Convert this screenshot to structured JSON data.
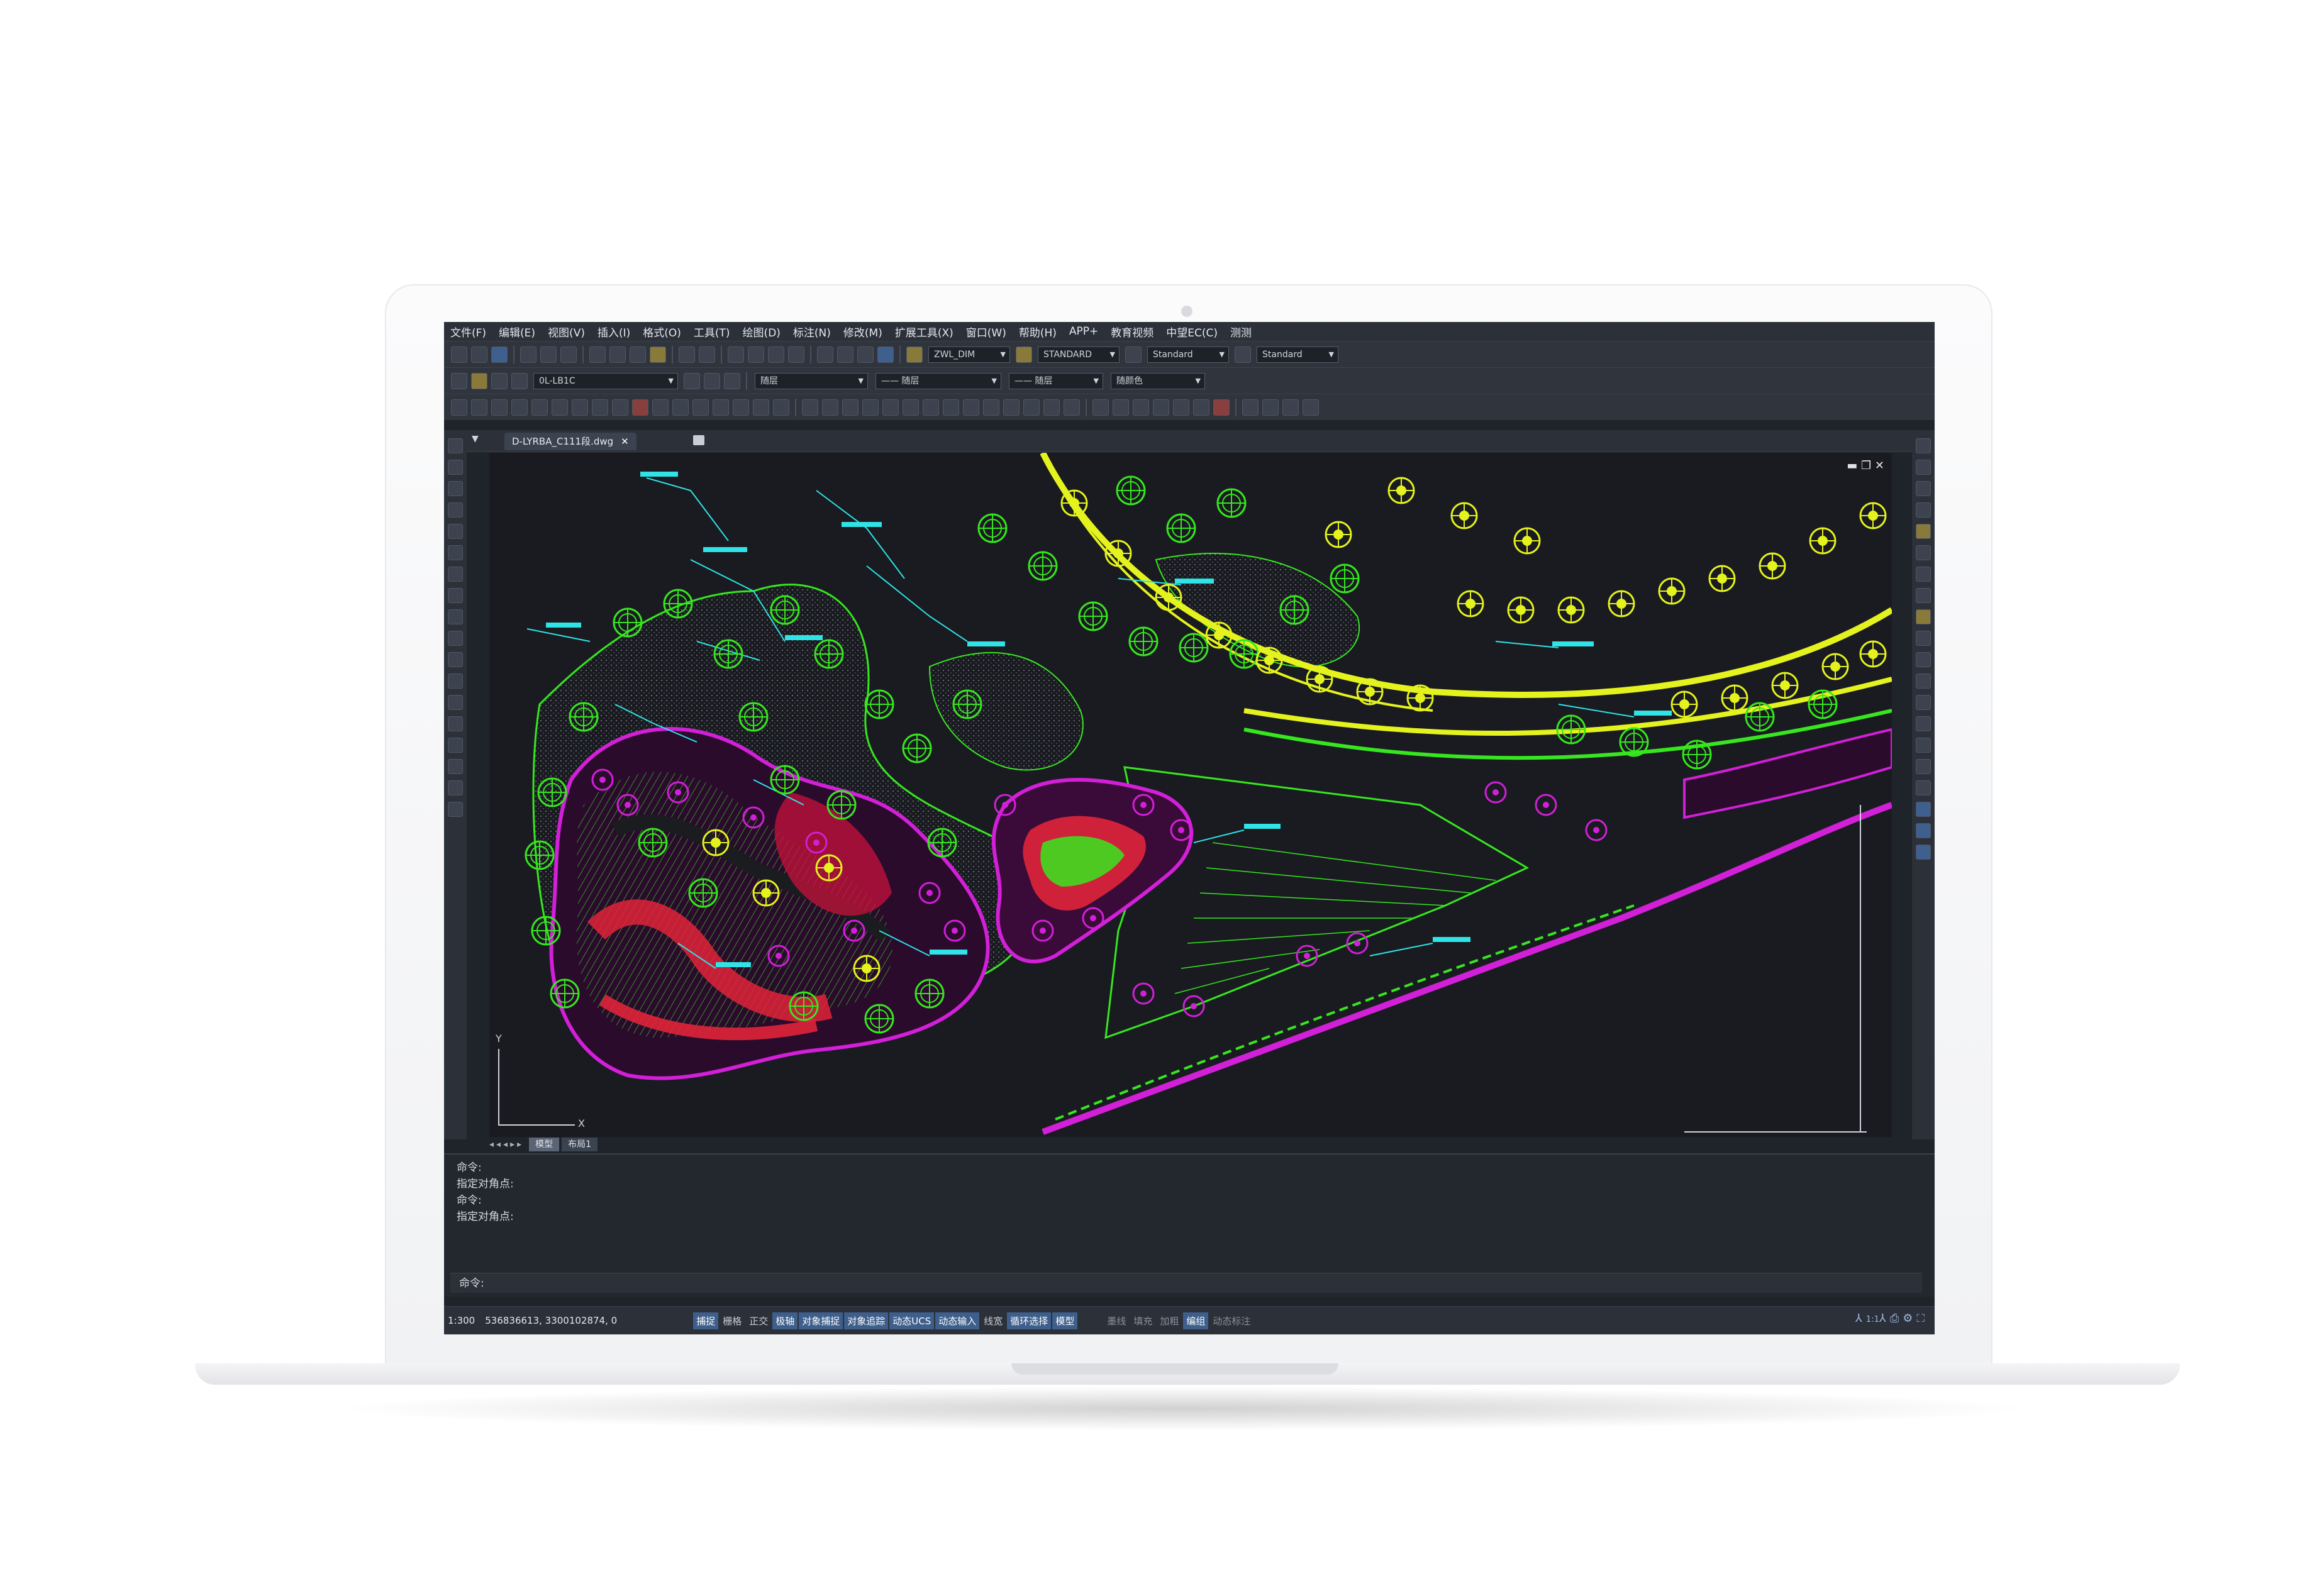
{
  "menu": [
    "文件(F)",
    "编辑(E)",
    "视图(V)",
    "插入(I)",
    "格式(O)",
    "工具(T)",
    "绘图(D)",
    "标注(N)",
    "修改(M)",
    "扩展工具(X)",
    "窗口(W)",
    "帮助(H)",
    "APP+",
    "教育视频",
    "中望EC(C)",
    "测测"
  ],
  "toolbar1": {
    "dimstyle": "ZWL_DIM",
    "textstyle": "STANDARD",
    "tablestyle": "Standard",
    "mleaderstyle": "Standard"
  },
  "toolbar2": {
    "layer": "0L-LB1C",
    "color": "随层",
    "linetype": "—— 随层",
    "lineweight": "—— 随层",
    "plotstyle": "随颜色"
  },
  "document": {
    "tab_label": "D-LYRBA_C111段.dwg",
    "close_icon": "✕"
  },
  "layout_tabs": [
    "模型",
    "布局1"
  ],
  "command_history": [
    "命令:",
    "指定对角点:",
    "命令:",
    "指定对角点:"
  ],
  "command_prompt": "命令:",
  "status": {
    "scale": "1:300",
    "coordinates": "536836613, 3300102874, 0",
    "buttons_on": [
      "捕捉",
      "栅格",
      "正交",
      "极轴",
      "对象捕捉",
      "对象追踪",
      "动态UCS",
      "动态输入",
      "线宽",
      "循环选择",
      "模型"
    ],
    "buttons_off": [
      "墨线",
      "填充",
      "加粗",
      "编组",
      "动态标注"
    ],
    "annotation_scale": "1:1"
  },
  "colors": {
    "screen_bg": "#1f232a",
    "canvas_bg": "#191b20",
    "accent": "#3e5f8c",
    "green": "#37e61f",
    "yellow": "#e4f21d",
    "magenta": "#d21fd8",
    "red": "#e0233a",
    "cyan": "#2fe3e6"
  }
}
